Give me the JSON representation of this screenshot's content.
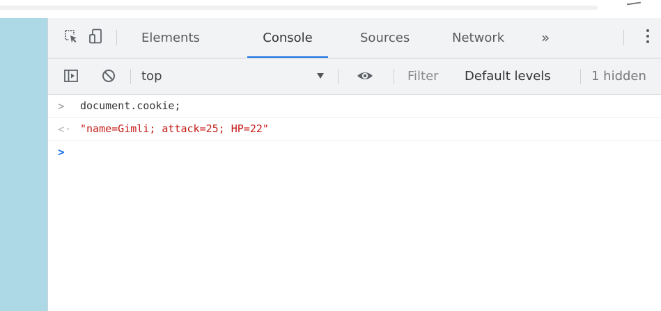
{
  "devtools": {
    "tabs": [
      {
        "label": "Elements"
      },
      {
        "label": "Console"
      },
      {
        "label": "Sources"
      },
      {
        "label": "Network"
      }
    ],
    "more_tabs_glyph": "»",
    "active_tab": "Console"
  },
  "console_toolbar": {
    "context": "top",
    "filter_placeholder": "Filter",
    "levels_label": "Default levels",
    "hidden_label": "1 hidden"
  },
  "console": {
    "entries": [
      {
        "kind": "input",
        "prompt": ">",
        "text": "document.cookie;"
      },
      {
        "kind": "result",
        "prompt": "<·",
        "text": "\"name=Gimli; attack=25; HP=22\""
      },
      {
        "kind": "prompt",
        "prompt": ">",
        "text": ""
      }
    ]
  },
  "icons": {
    "inspect": "inspect-element-icon",
    "device": "device-toolbar-icon",
    "sidebar": "show-sidebar-icon",
    "clear": "clear-console-icon",
    "eye": "live-expression-eye-icon",
    "menu": "kebab-menu-icon"
  },
  "colors": {
    "page_background": "#add8e6",
    "active_tab_underline": "#1a73e8",
    "result_string": "#c41a16",
    "prompt_caret": "#1a73e8"
  }
}
